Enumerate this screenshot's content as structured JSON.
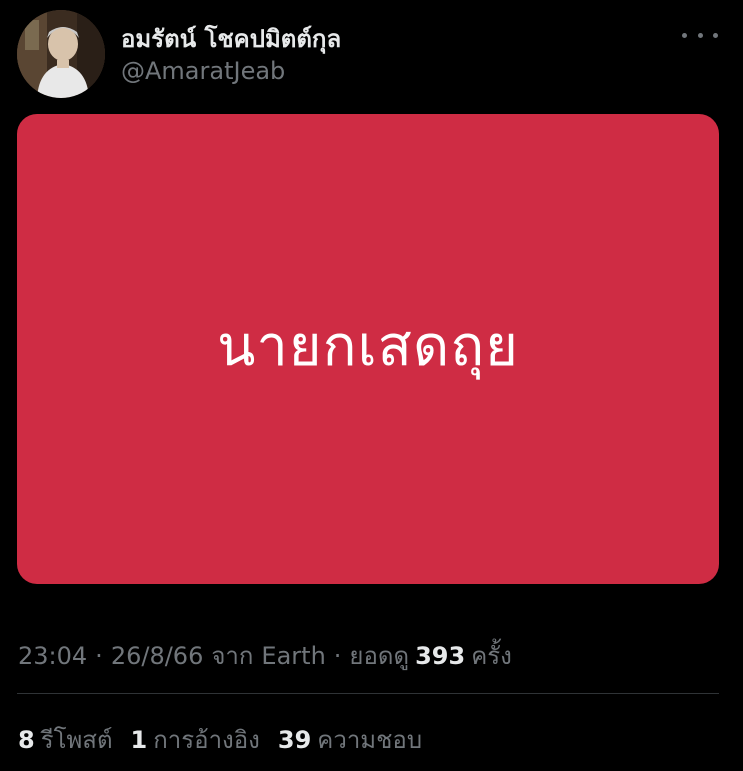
{
  "tweet": {
    "author": {
      "display_name": "อมรัตน์ โชคปมิตต์กุล",
      "handle": "@AmaratJeab"
    },
    "media": {
      "text": "นายกเสดถุย",
      "background_color": "#cf2c44"
    },
    "meta": {
      "time": "23:04",
      "date": "26/8/66",
      "source_prefix": "จาก",
      "source": "Earth",
      "views_label": "ยอดดู",
      "views_count": "393",
      "views_suffix": "ครั้ง"
    },
    "stats": {
      "retweets_count": "8",
      "retweets_label": "รีโพสต์",
      "quotes_count": "1",
      "quotes_label": "การอ้างอิง",
      "likes_count": "39",
      "likes_label": "ความชอบ"
    },
    "icons": {
      "more": "more-horizontal-icon"
    },
    "colors": {
      "background": "#000000",
      "primary_text": "#e7e9ea",
      "secondary_text": "#71767b",
      "divider": "#2f3336"
    }
  }
}
